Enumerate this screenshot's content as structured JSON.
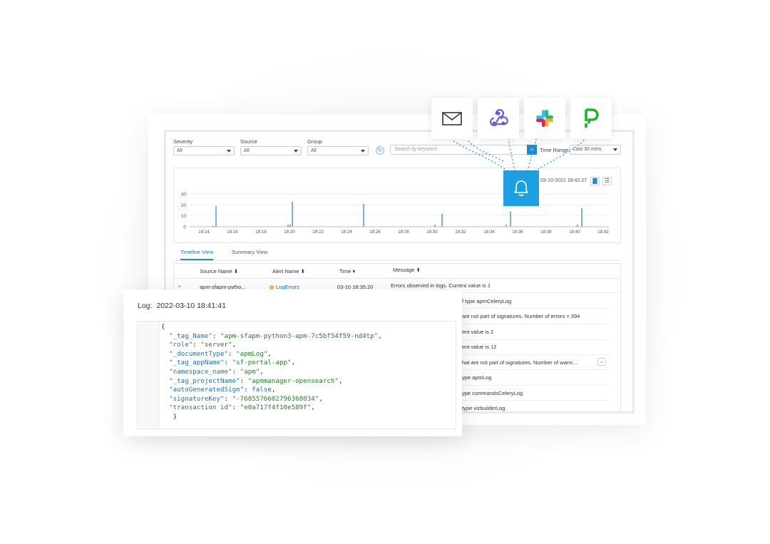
{
  "filters": {
    "severity": {
      "label": "Severity",
      "value": "All"
    },
    "source": {
      "label": "Source",
      "value": "All"
    },
    "group": {
      "label": "Group",
      "value": "All"
    },
    "search_placeholder": "Search by keyword",
    "time_range": {
      "label": "Time Range:",
      "value": "Last 30 mins"
    }
  },
  "chart": {
    "datestamp": "03-10-2022 18:42:27"
  },
  "chart_data": {
    "type": "bar",
    "ylim": [
      0,
      30
    ],
    "yticks": [
      0,
      10,
      20,
      30
    ],
    "xticks": [
      "18:14",
      "18:16",
      "18:18",
      "18:20",
      "18:22",
      "18:24",
      "18:26",
      "18:28",
      "18:30",
      "18:32",
      "18:34",
      "18:36",
      "18:38",
      "18:40",
      "18:42"
    ],
    "x_range_minutes": [
      13.0,
      42.4
    ],
    "bars": [
      {
        "t": 14.6,
        "v": 1
      },
      {
        "t": 14.85,
        "v": 19
      },
      {
        "t": 19.9,
        "v": 2
      },
      {
        "t": 20.05,
        "v": 2
      },
      {
        "t": 20.2,
        "v": 23
      },
      {
        "t": 25.2,
        "v": 21
      },
      {
        "t": 30.2,
        "v": 2
      },
      {
        "t": 30.7,
        "v": 12
      },
      {
        "t": 35.2,
        "v": 2
      },
      {
        "t": 35.5,
        "v": 14
      },
      {
        "t": 40.2,
        "v": 2
      },
      {
        "t": 40.5,
        "v": 17
      }
    ],
    "title": "",
    "xlabel": "",
    "ylabel": "",
    "color": "#7ab6dc"
  },
  "tabs": [
    {
      "label": "Timeline View"
    },
    {
      "label": "Summary View"
    }
  ],
  "table": {
    "headers": [
      "Source Name ⬍",
      "Alert Name ⬍",
      "Time ▾",
      "Message ⬍"
    ],
    "first_row": {
      "source": "apm-sfapm-pytho...",
      "alert": "LogErrors",
      "time": "03-10 18:35:20",
      "message": "Errors observed in logs. Current value is 1"
    },
    "messages": [
      "f type apmCeleryLog",
      "are not part of signatures. Number of errors = 394",
      "ent value is 2",
      "ent value is 12",
      "hat are not part of signatures. Number of warni...",
      "ype apmLog",
      "ype commandsCeleryLog",
      "type vizbuilderLog"
    ]
  },
  "log": {
    "label": "Log:",
    "timestamp": "2022-03-10 18:41:41",
    "open": "{",
    "close": "}",
    "lines": [
      {
        "key": "\"_tag_Name\"",
        "val": "\"apm-sfapm-python3-apm-7c5bf54f59-nd4tp\"",
        "vtype": "s"
      },
      {
        "key": "\"role\"",
        "val": "\"server\"",
        "vtype": "s"
      },
      {
        "key": "\"_documentType\"",
        "val": "\"apmLog\"",
        "vtype": "s"
      },
      {
        "key": "\"_tag_appName\"",
        "val": "\"sf-portal-app\"",
        "vtype": "s"
      },
      {
        "key": "\"namespace_name\"",
        "val": "\"apm\"",
        "vtype": "s"
      },
      {
        "key": "\"_tag_projectName\"",
        "val": "\"apmmanager-opensearch\"",
        "vtype": "s"
      },
      {
        "key": "\"autoGeneratedSign\"",
        "val": "false",
        "vtype": "b"
      },
      {
        "key": "\"signatureKey\"",
        "val": "\"-7685576602796368034\"",
        "vtype": "s"
      },
      {
        "key": "\"transaction id\"",
        "val": "\"e0a717f4f10e589f\"",
        "vtype": "s"
      }
    ]
  },
  "integrations": [
    "email-icon",
    "webhook-icon",
    "slack-icon",
    "pagerduty-icon"
  ],
  "colors": {
    "accent": "#1e9fe2",
    "bar": "#7ab6dc",
    "webhook": "#6f5bd6",
    "pagerduty": "#1db32f"
  }
}
